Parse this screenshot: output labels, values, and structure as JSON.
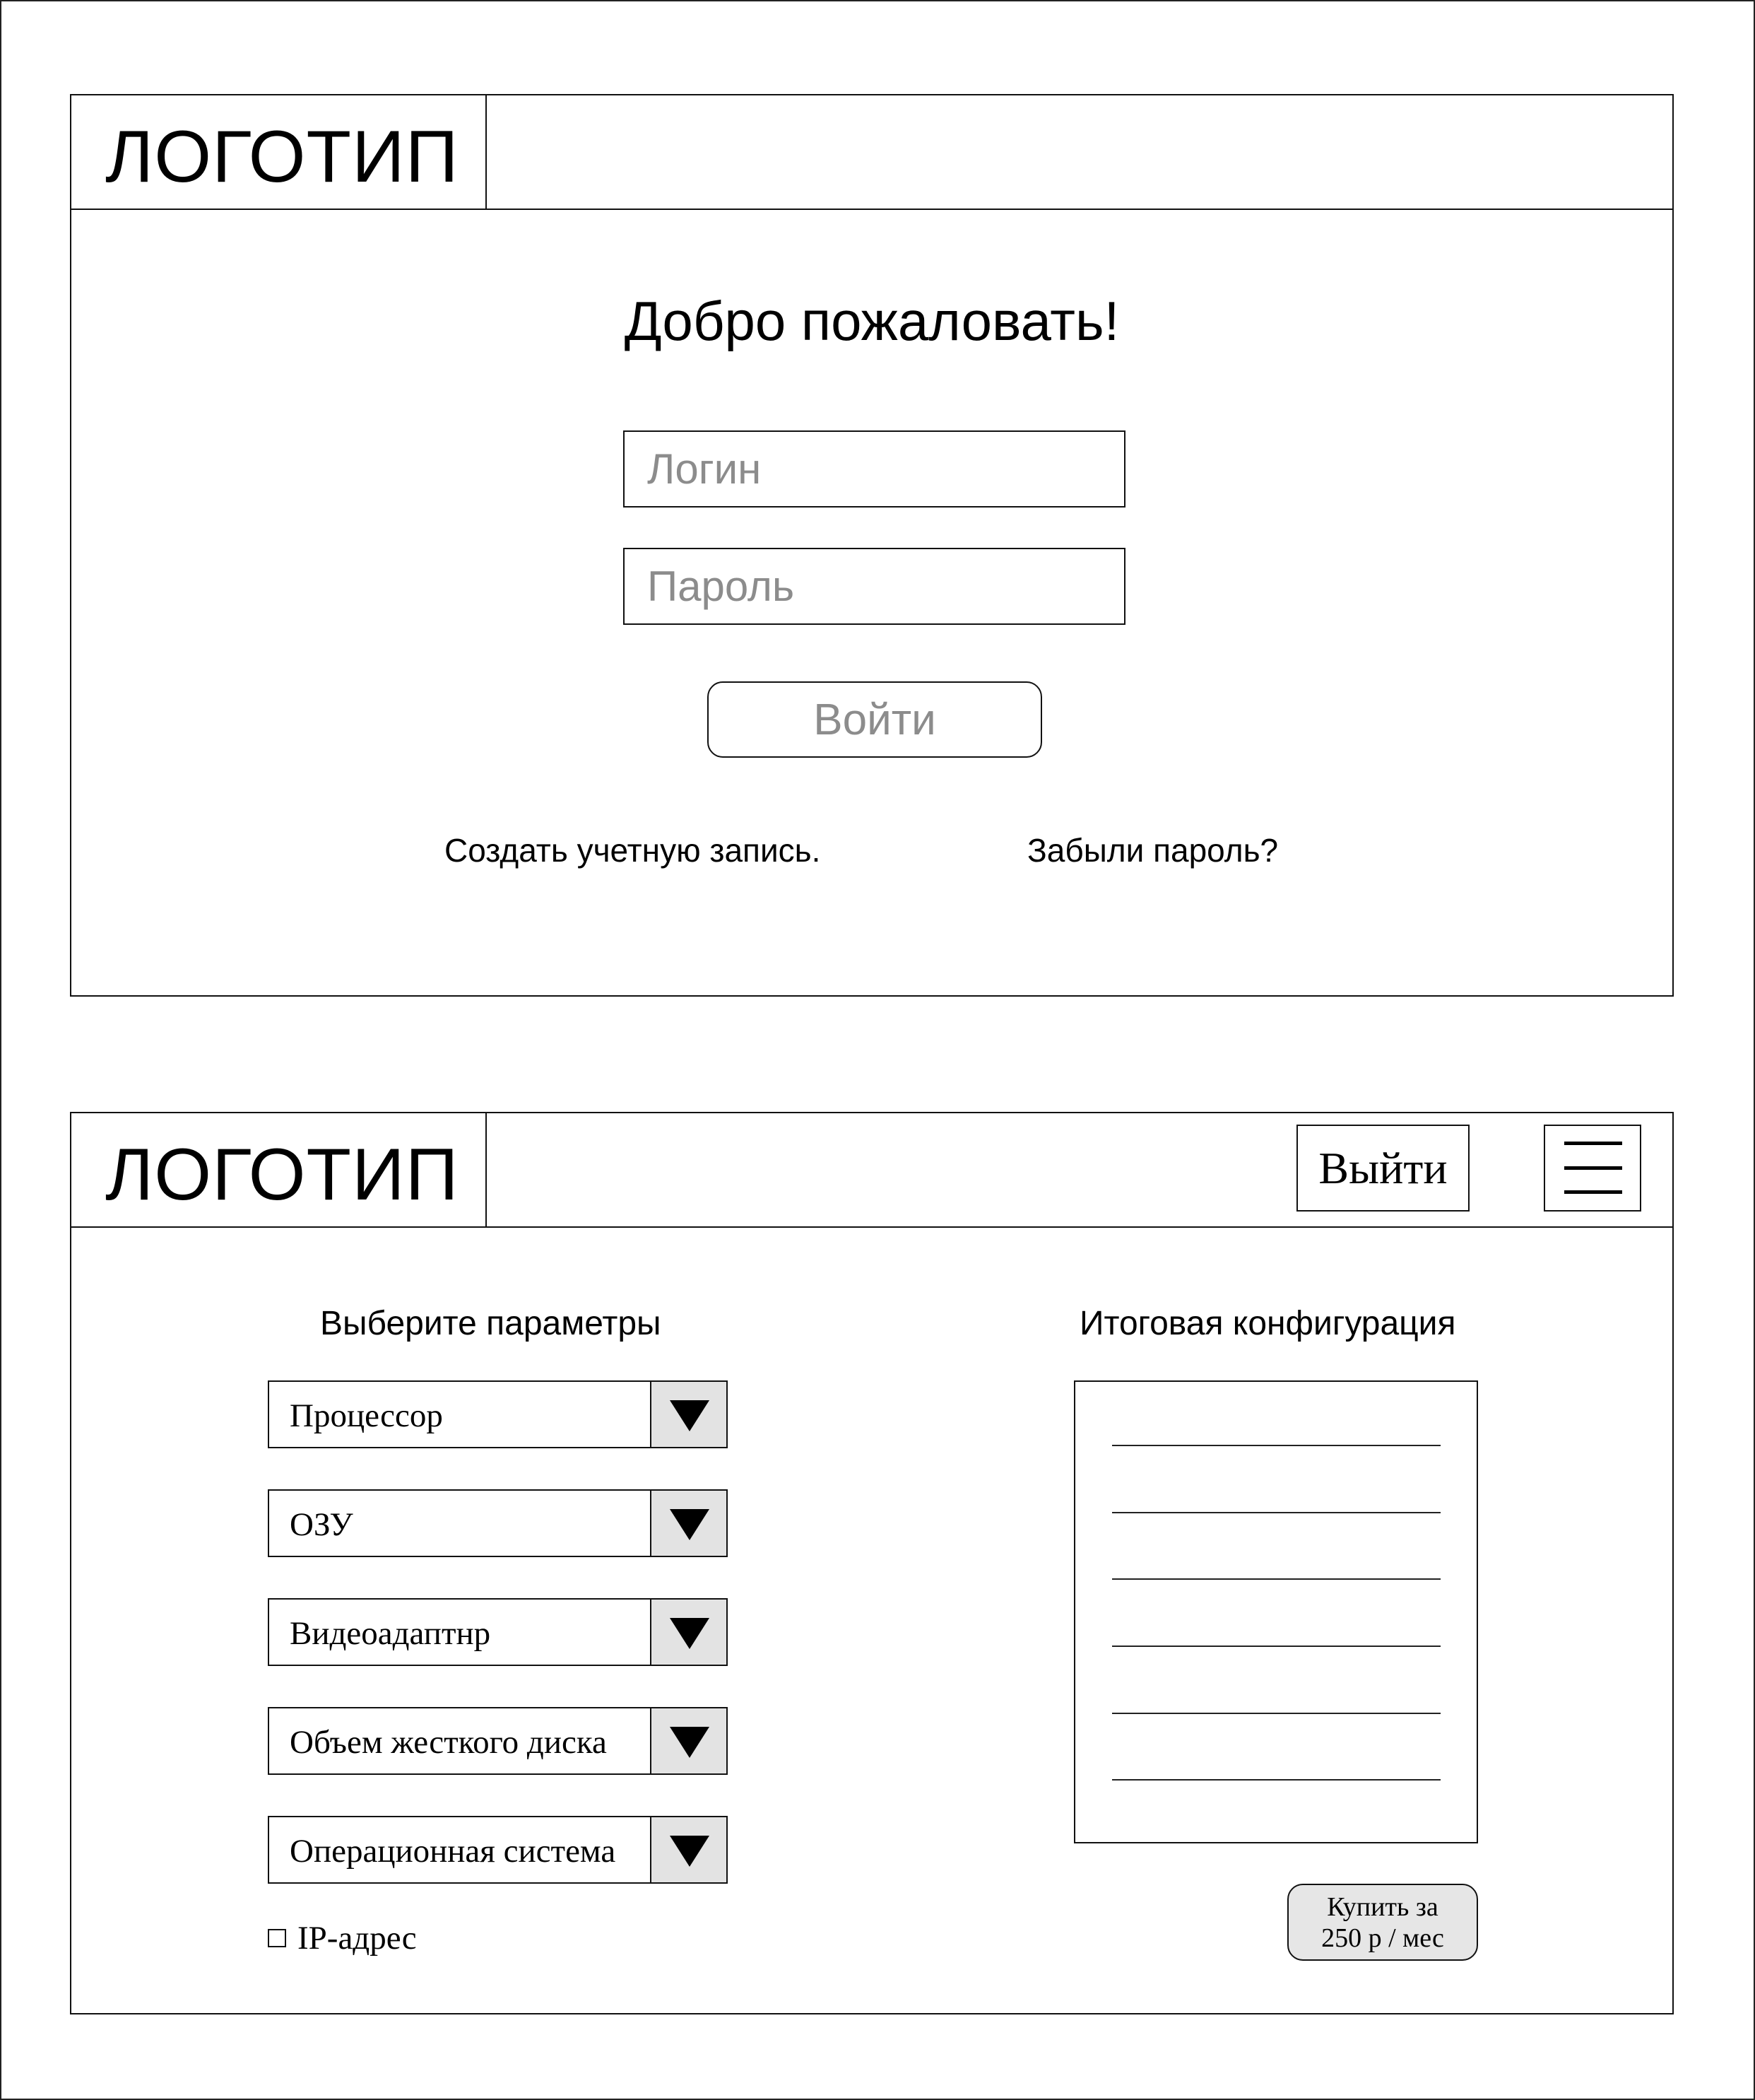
{
  "login_screen": {
    "logo": "ЛОГОТИП",
    "welcome": "Добро пожаловать!",
    "login_placeholder": "Логин",
    "password_placeholder": "Пароль",
    "submit_label": "Войти",
    "create_account_link": "Создать учетную запись.",
    "forgot_password_link": "Забыли пароль?"
  },
  "config_screen": {
    "logo": "ЛОГОТИП",
    "logout_label": "Выйти",
    "menu_icon": "hamburger-menu-icon",
    "params_title": "Выберите параметры",
    "summary_title": "Итоговая конфигурация",
    "dropdowns": [
      {
        "label": "Процессор"
      },
      {
        "label": "ОЗУ"
      },
      {
        "label": "Видеоадаптнр"
      },
      {
        "label": "Объем жесткого диска"
      },
      {
        "label": "Операционная система"
      }
    ],
    "checkbox_label": "IP-адрес",
    "checkbox_checked": false,
    "summary_lines_count": 6,
    "buy_line1": "Купить за",
    "buy_line2": "250 р / мес"
  }
}
